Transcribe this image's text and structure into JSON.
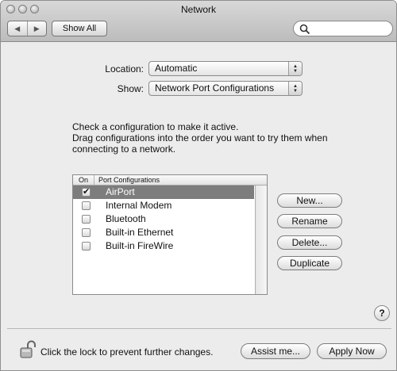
{
  "window": {
    "title": "Network"
  },
  "toolbar": {
    "back_glyph": "◀",
    "forward_glyph": "▶",
    "show_all_label": "Show All",
    "search_value": ""
  },
  "location": {
    "label": "Location:",
    "value": "Automatic"
  },
  "show": {
    "label": "Show:",
    "value": "Network Port Configurations"
  },
  "instructions": [
    "Check a configuration to make it active.",
    "Drag configurations into the order you want to try them when",
    "connecting to a network."
  ],
  "port_list": {
    "columns": [
      "On",
      "Port Configurations"
    ],
    "rows": [
      {
        "label": "AirPort",
        "checked": true,
        "selected": true
      },
      {
        "label": "Internal Modem",
        "checked": false,
        "selected": false
      },
      {
        "label": "Bluetooth",
        "checked": false,
        "selected": false
      },
      {
        "label": "Built-in Ethernet",
        "checked": false,
        "selected": false
      },
      {
        "label": "Built-in FireWire",
        "checked": false,
        "selected": false
      }
    ]
  },
  "buttons": {
    "new": "New...",
    "rename": "Rename",
    "delete": "Delete...",
    "duplicate": "Duplicate"
  },
  "help_glyph": "?",
  "footer": {
    "lock_text": "Click the lock to prevent further changes.",
    "assist_label": "Assist me...",
    "apply_label": "Apply Now"
  },
  "colors": {
    "selection": "#7d7d7d",
    "window_bg": "#ececec"
  }
}
